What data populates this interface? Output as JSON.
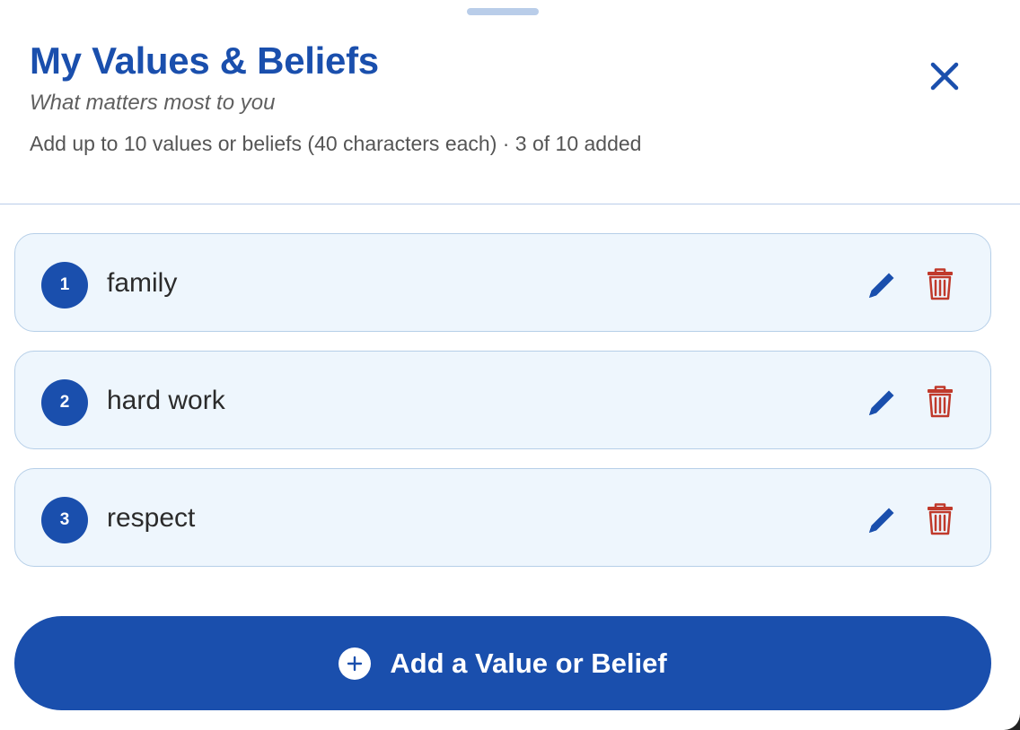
{
  "header": {
    "title": "My Values & Beliefs",
    "subtitle": "What matters most to you",
    "limits": "Add up to 10 values or beliefs (40 characters each) · 3 of 10 added"
  },
  "values": [
    {
      "number": "1",
      "text": "family"
    },
    {
      "number": "2",
      "text": "hard work"
    },
    {
      "number": "3",
      "text": "respect"
    }
  ],
  "add_button": {
    "label": "Add a Value or Belief"
  },
  "icons": {
    "close": "close-icon",
    "edit": "pencil-icon",
    "delete": "trash-icon",
    "add": "plus-circle-icon"
  },
  "colors": {
    "primary": "#1a4fad",
    "item_background": "#eef6fd",
    "item_border": "#b6cfe8",
    "delete": "#c0392b"
  }
}
